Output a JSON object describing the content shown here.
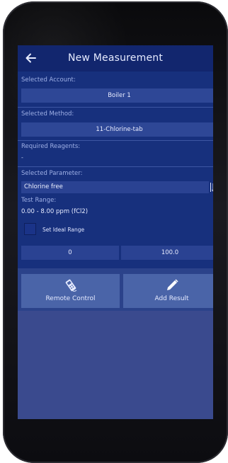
{
  "header": {
    "title": "New Measurement",
    "back_icon": "arrow-left-icon"
  },
  "account": {
    "label": "Selected Account:",
    "value": "Boiler 1"
  },
  "method": {
    "label": "Selected Method:",
    "value": "11-Chlorine-tab"
  },
  "reagents": {
    "label": "Required Reagents:",
    "value": "-"
  },
  "parameter": {
    "label": "Selected Parameter:",
    "value": "Chlorine free",
    "sort_icon": "sort-icon"
  },
  "test_range": {
    "label": "Test Range:",
    "value": "0.00 - 8.00 ppm (fCl2)"
  },
  "ideal_range": {
    "checkbox_label": "Set Ideal Range",
    "checked": false,
    "min": "0",
    "max": "100.0"
  },
  "actions": {
    "remote_label": "Remote Control",
    "remote_icon": "remote-device-icon",
    "add_label": "Add Result",
    "add_icon": "pencil-icon"
  },
  "colors": {
    "header_bg": "#12266e",
    "content_bg": "#17307d",
    "field_bg": "#2e4796",
    "button_bg": "#4a64a8",
    "screen_bg": "#3a4a8e"
  }
}
